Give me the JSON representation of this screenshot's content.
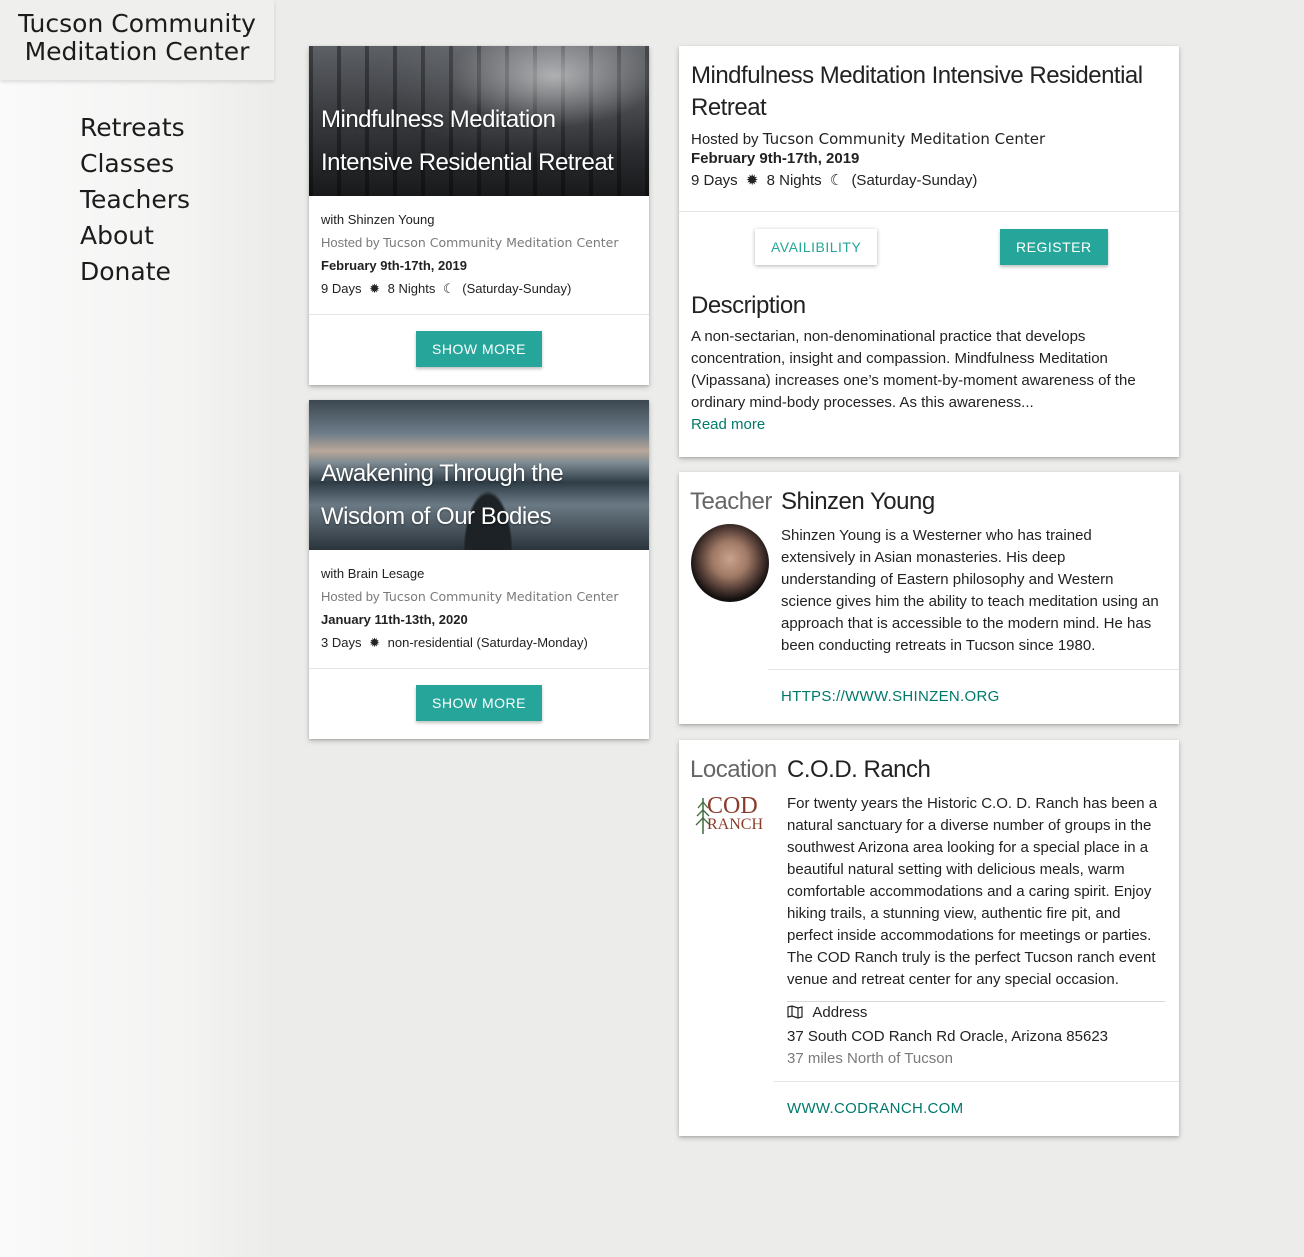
{
  "site": {
    "brand_line1": "Tucson Community",
    "brand_line2": "Meditation Center"
  },
  "nav": {
    "items": [
      {
        "label": "Retreats"
      },
      {
        "label": "Classes"
      },
      {
        "label": "Teachers"
      },
      {
        "label": "About"
      },
      {
        "label": "Donate"
      }
    ]
  },
  "retreat_cards": [
    {
      "title_line1": "Mindfulness Meditation",
      "title_line2": "Intensive Residential Retreat",
      "teacher": "with Shinzen Young",
      "hosted_by_label": "Hosted by",
      "host": "Tucson Community Meditation Center",
      "dates": "February 9th-17th, 2019",
      "days": "9 Days",
      "nights": "8 Nights",
      "span": "(Saturday-Sunday)",
      "button": "SHOW MORE"
    },
    {
      "title_line1": "Awakening Through the",
      "title_line2": "Wisdom of Our Bodies",
      "teacher": "with Brain Lesage",
      "hosted_by_label": "Hosted by",
      "host": "Tucson Community Meditation Center",
      "dates": "January 11th-13th, 2020",
      "days": "3 Days",
      "span": "non-residential (Saturday-Monday)",
      "button": "SHOW MORE"
    }
  ],
  "detail": {
    "title_line1": "Mindfulness Meditation Intensive Residential",
    "title_line2": "Retreat",
    "hosted_by_label": "Hosted by",
    "host": "Tucson Community Meditation Center",
    "dates": "February 9th-17th, 2019",
    "days": "9 Days",
    "nights": "8 Nights",
    "span": "(Saturday-Sunday)",
    "availability_button": "AVAILIBILITY",
    "register_button": "REGISTER",
    "description_heading": "Description",
    "description_lines": [
      "A non-sectarian, non-denominational practice that develops",
      "concentration, insight and compassion. Mindfulness Meditation",
      "(Vipassana) increases one’s moment-by-moment awareness of the",
      "ordinary mind-body processes. As this awareness..."
    ],
    "read_more": "Read more"
  },
  "teacher": {
    "label": "Teacher",
    "name": "Shinzen Young",
    "bio_lines": [
      "Shinzen Young is a Westerner who has trained",
      "extensively in Asian monasteries. His deep",
      "understanding of Eastern philosophy and Western",
      "science gives him the ability to teach meditation using an",
      "approach that is accessible to the modern mind. He has",
      "been conducting retreats in Tucson since 1980."
    ],
    "link": "HTTPS://WWW.SHINZEN.ORG"
  },
  "location": {
    "label": "Location",
    "name": "C.O.D. Ranch",
    "logo_text_top": "COD",
    "logo_text_bottom": "RANCH",
    "desc_lines": [
      "For twenty years the Historic C.O. D. Ranch has been a",
      "natural sanctuary for a diverse number of groups in the",
      "southwest Arizona area looking for a special place in a",
      "beautiful natural setting with delicious meals, warm",
      "comfortable accommodations and a caring spirit. Enjoy",
      "hiking trails, a stunning view, authentic fire pit, and",
      "perfect inside accommodations for meetings or parties.",
      "The COD Ranch truly is the perfect Tucson ranch event",
      "venue and retreat center for any special occasion."
    ],
    "address_label": "Address",
    "address": "37 South COD Ranch Rd Oracle, Arizona 85623",
    "distance": "37 miles North of Tucson",
    "link": "WWW.CODRANCH.COM"
  },
  "colors": {
    "accent": "#26a69a",
    "link": "#00796b",
    "background": "#ececea"
  },
  "icons": {
    "sun": "sun-icon",
    "moon": "moon-icon",
    "map": "map-icon"
  }
}
